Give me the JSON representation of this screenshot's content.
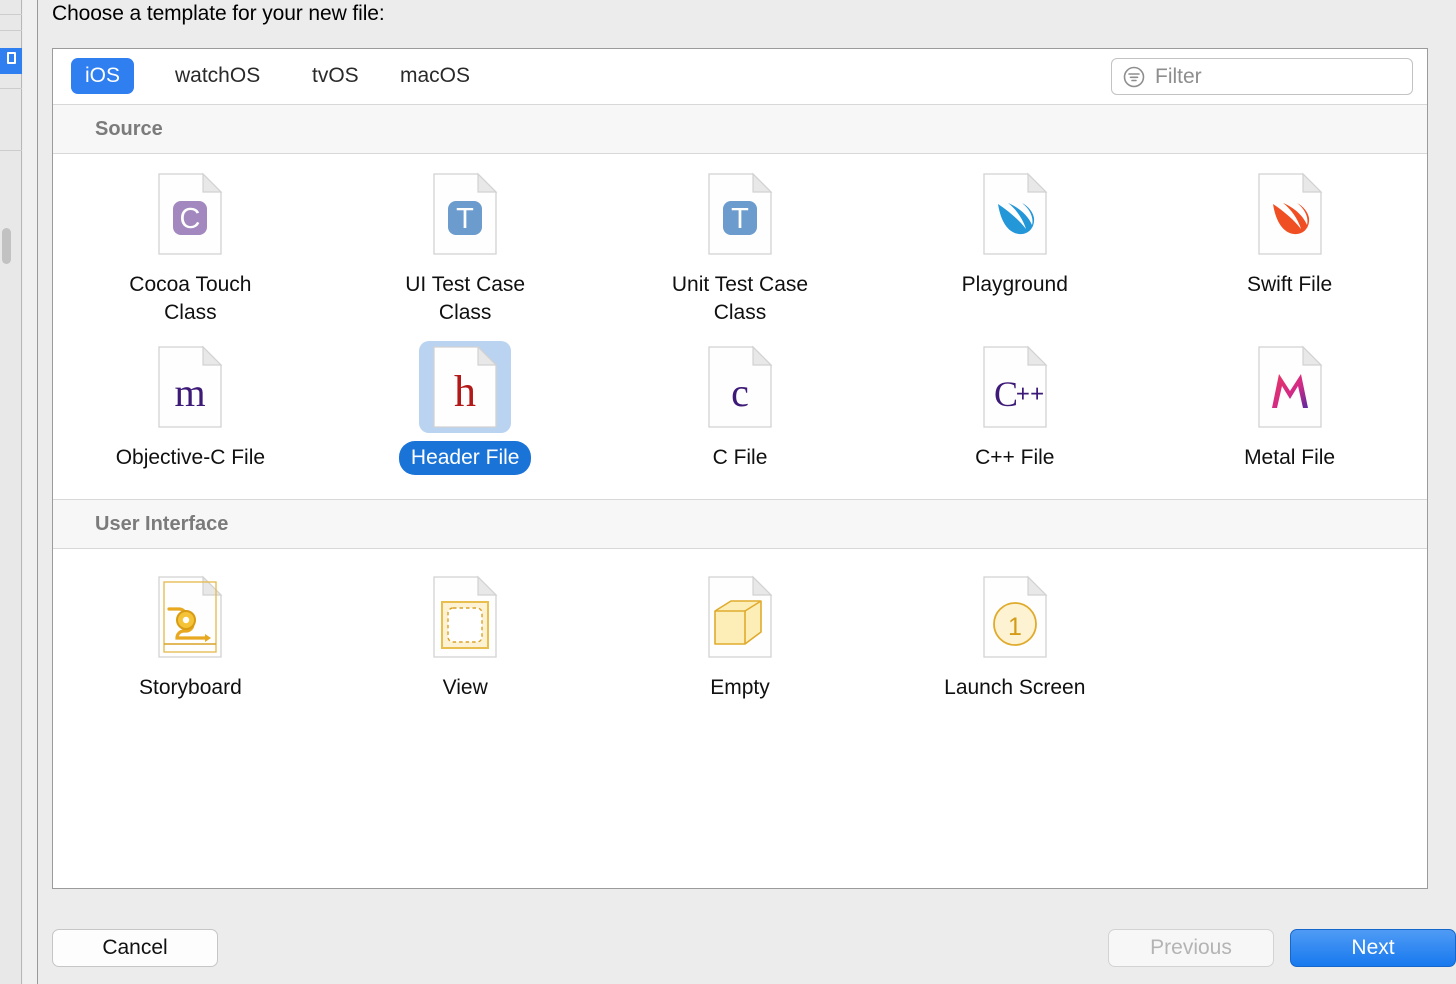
{
  "sheet": {
    "title": "Choose a template for your new file:"
  },
  "platform_tabs": [
    {
      "label": "iOS",
      "selected": true
    },
    {
      "label": "watchOS",
      "selected": false
    },
    {
      "label": "tvOS",
      "selected": false
    },
    {
      "label": "macOS",
      "selected": false
    }
  ],
  "filter": {
    "placeholder": "Filter",
    "value": "",
    "icon": "filter-icon"
  },
  "sections": [
    {
      "title": "Source",
      "rows": [
        [
          {
            "label": "Cocoa Touch Class",
            "icon": "cocoa-touch-class-icon",
            "selected": false
          },
          {
            "label": "UI Test Case Class",
            "icon": "ui-test-case-class-icon",
            "selected": false
          },
          {
            "label": "Unit Test Case Class",
            "icon": "unit-test-case-class-icon",
            "selected": false
          },
          {
            "label": "Playground",
            "icon": "playground-icon",
            "selected": false
          },
          {
            "label": "Swift File",
            "icon": "swift-file-icon",
            "selected": false
          }
        ],
        [
          {
            "label": "Objective-C File",
            "icon": "objective-c-file-icon",
            "selected": false
          },
          {
            "label": "Header File",
            "icon": "header-file-icon",
            "selected": true
          },
          {
            "label": "C File",
            "icon": "c-file-icon",
            "selected": false
          },
          {
            "label": "C++ File",
            "icon": "cpp-file-icon",
            "selected": false
          },
          {
            "label": "Metal File",
            "icon": "metal-file-icon",
            "selected": false
          }
        ]
      ]
    },
    {
      "title": "User Interface",
      "rows": [
        [
          {
            "label": "Storyboard",
            "icon": "storyboard-icon",
            "selected": false
          },
          {
            "label": "View",
            "icon": "view-icon",
            "selected": false
          },
          {
            "label": "Empty",
            "icon": "empty-icon",
            "selected": false
          },
          {
            "label": "Launch Screen",
            "icon": "launch-screen-icon",
            "selected": false
          }
        ]
      ]
    }
  ],
  "footer": {
    "cancel_label": "Cancel",
    "previous_label": "Previous",
    "previous_disabled": true,
    "next_label": "Next"
  },
  "colors": {
    "accent_blue": "#2f7ff0",
    "selection_fill": "#b9d3f0",
    "selection_pill": "#1a74d8",
    "section_header_text": "#7b7b7b",
    "sheet_background": "#ececec"
  }
}
